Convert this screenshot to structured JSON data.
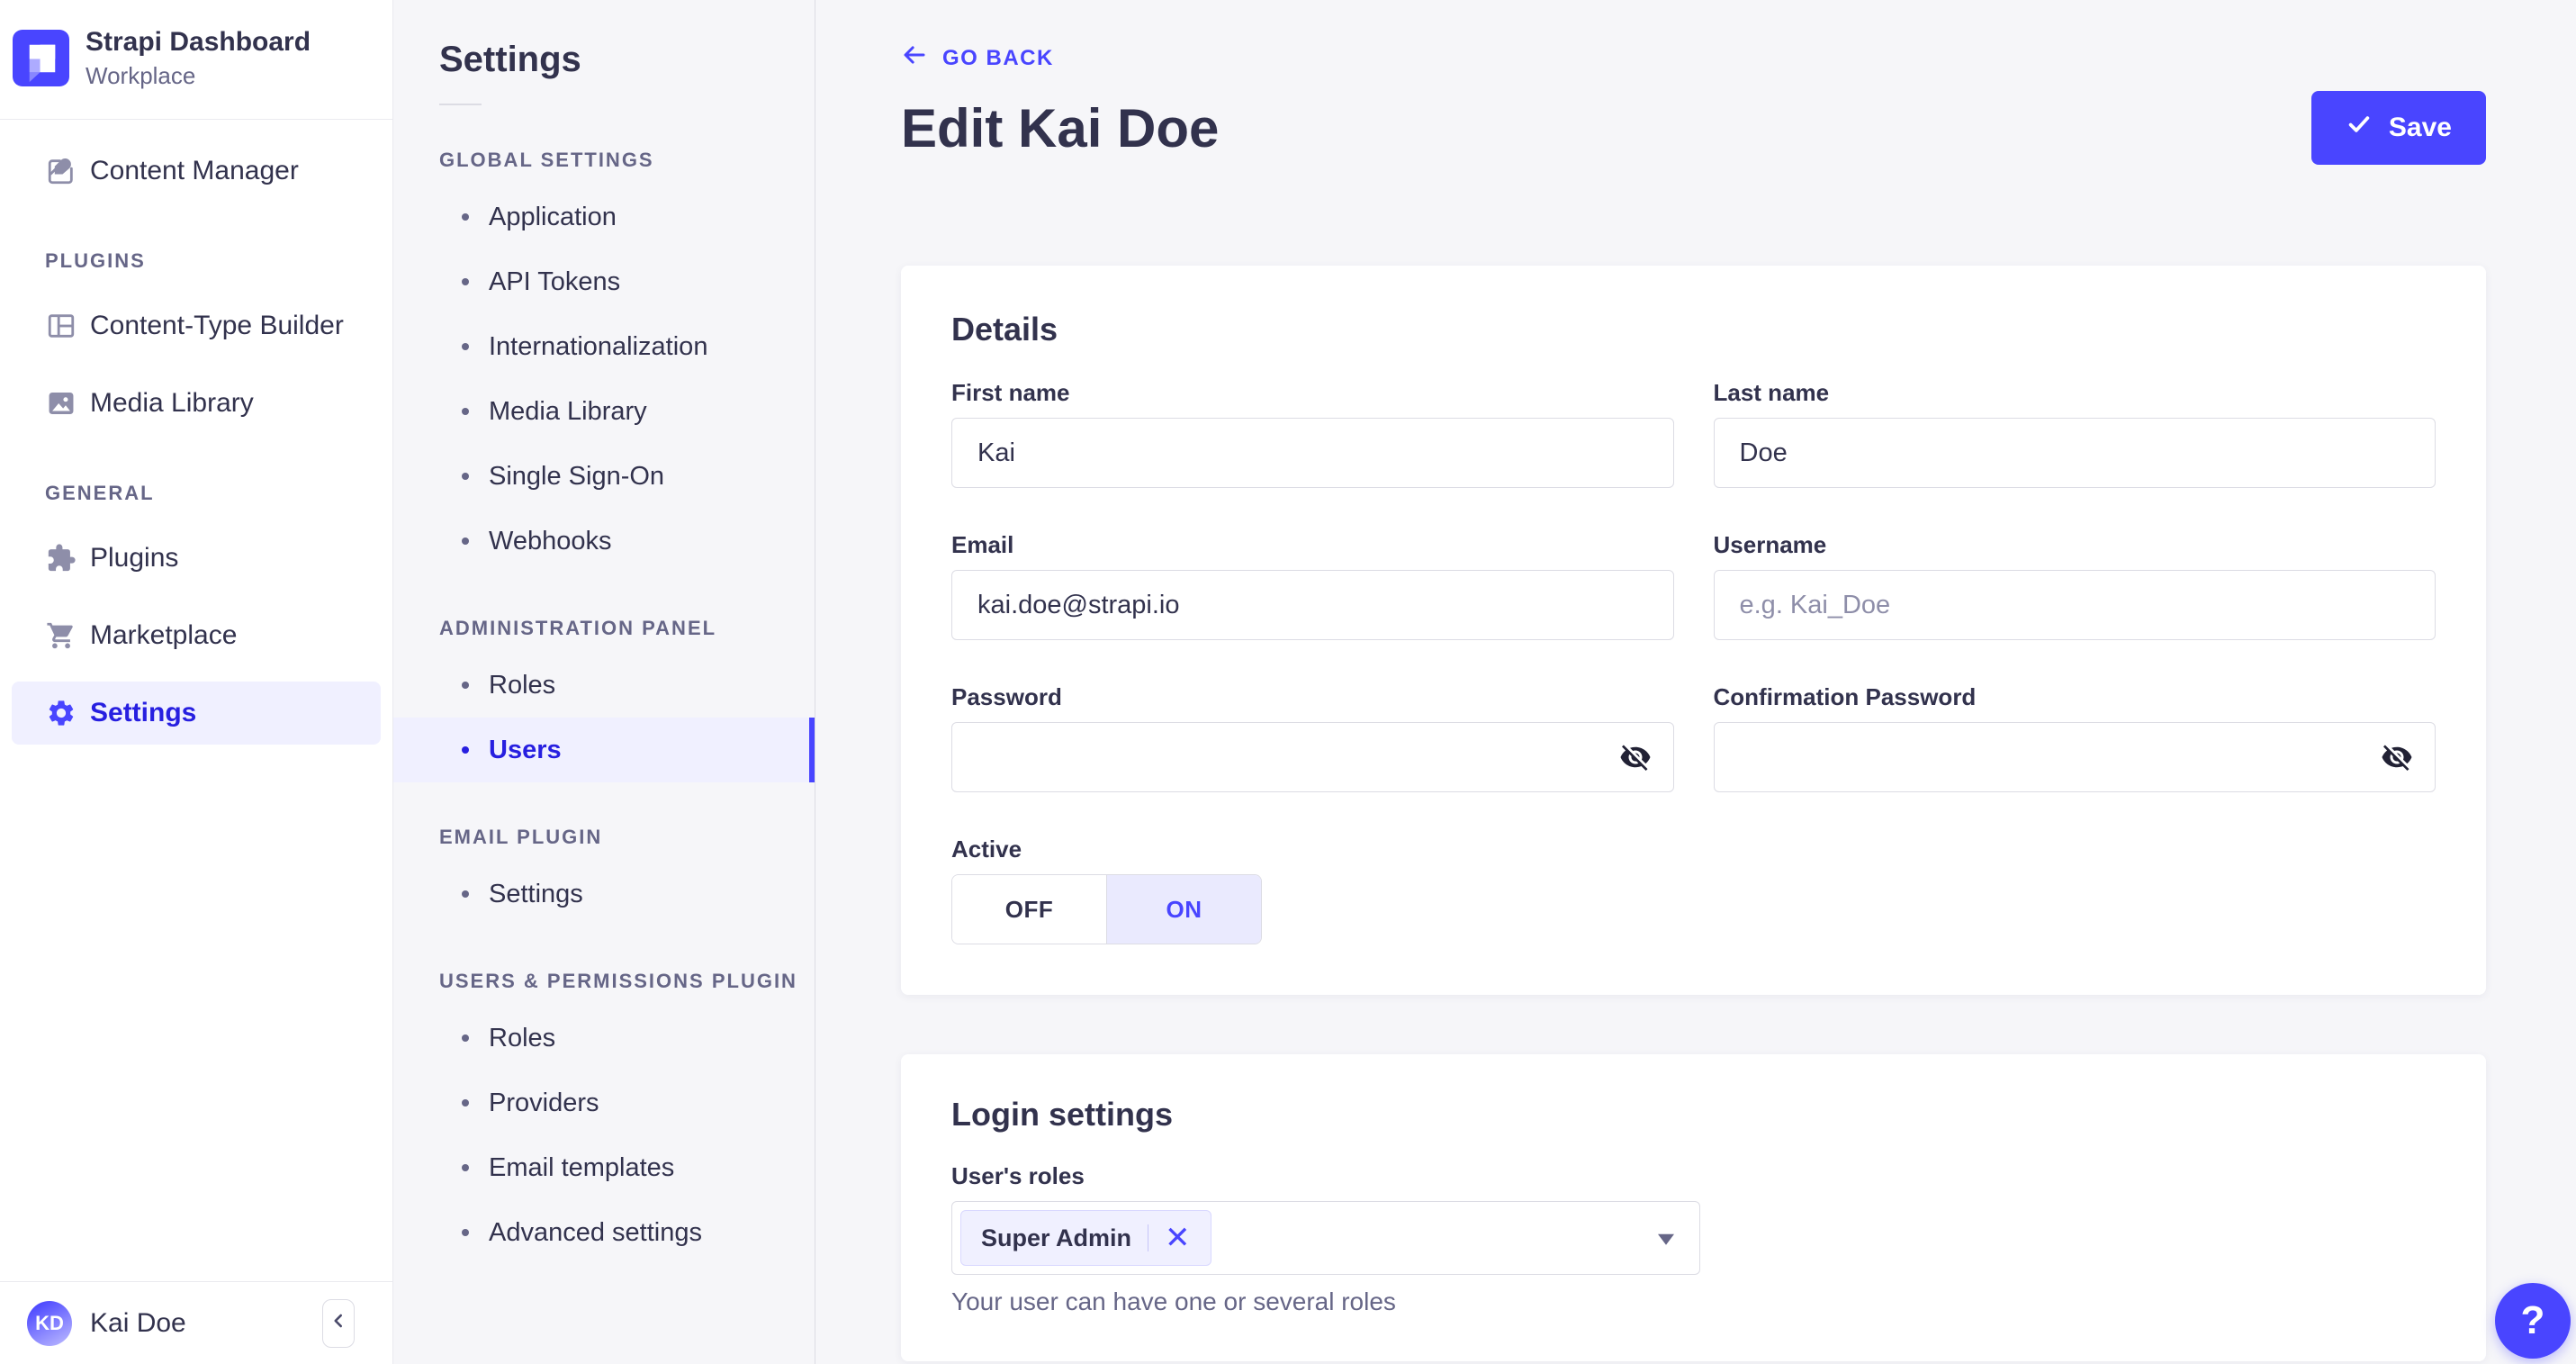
{
  "colors": {
    "primary": "#4945FF",
    "primary_active_text": "#271FE0",
    "primary_light_bg": "#F0F0FF",
    "text": "#32324D",
    "text_muted": "#666687",
    "border": "#DCDCE4"
  },
  "icons": {
    "brand": "strapi-logo-icon",
    "content_manager": "feather-icon",
    "content_type_builder": "layout-icon",
    "media_library": "image-icon",
    "plugins": "puzzle-icon",
    "marketplace": "cart-icon",
    "settings": "gear-icon",
    "back": "arrow-left-icon",
    "save": "check-icon",
    "password": "eye-off-icon",
    "collapse": "chevron-left-icon",
    "help": "question-mark-icon"
  },
  "sidebar": {
    "app_title": "Strapi Dashboard",
    "workspace": "Workplace",
    "content_manager_label": "Content Manager",
    "sections": [
      {
        "title": "PLUGINS",
        "items": [
          {
            "label": "Content-Type Builder"
          },
          {
            "label": "Media Library"
          }
        ]
      },
      {
        "title": "GENERAL",
        "items": [
          {
            "label": "Plugins"
          },
          {
            "label": "Marketplace"
          },
          {
            "label": "Settings"
          }
        ]
      }
    ],
    "user": {
      "initials": "KD",
      "name": "Kai Doe"
    }
  },
  "subnav": {
    "title": "Settings",
    "sections": [
      {
        "title": "GLOBAL SETTINGS",
        "items": [
          "Application",
          "API Tokens",
          "Internationalization",
          "Media Library",
          "Single Sign-On",
          "Webhooks"
        ]
      },
      {
        "title": "ADMINISTRATION PANEL",
        "items": [
          "Roles",
          "Users"
        ]
      },
      {
        "title": "EMAIL PLUGIN",
        "items": [
          "Settings"
        ]
      },
      {
        "title": "USERS & PERMISSIONS PLUGIN",
        "items": [
          "Roles",
          "Providers",
          "Email templates",
          "Advanced settings"
        ]
      }
    ],
    "active_item": "Users"
  },
  "header": {
    "back_label": "GO BACK",
    "title": "Edit Kai Doe",
    "save_label": "Save"
  },
  "details_card": {
    "title": "Details",
    "fields": {
      "first_name": {
        "label": "First name",
        "value": "Kai"
      },
      "last_name": {
        "label": "Last name",
        "value": "Doe"
      },
      "email": {
        "label": "Email",
        "value": "kai.doe@strapi.io"
      },
      "username": {
        "label": "Username",
        "placeholder": "e.g. Kai_Doe"
      },
      "password": {
        "label": "Password"
      },
      "confirm_password": {
        "label": "Confirmation Password"
      },
      "active": {
        "label": "Active",
        "off_label": "OFF",
        "on_label": "ON",
        "value": "ON"
      }
    }
  },
  "login_card": {
    "title": "Login settings",
    "roles_label": "User's roles",
    "selected_roles": [
      {
        "name": "Super Admin"
      }
    ],
    "hint": "Your user can have one or several roles"
  },
  "help": {
    "label": "?"
  }
}
